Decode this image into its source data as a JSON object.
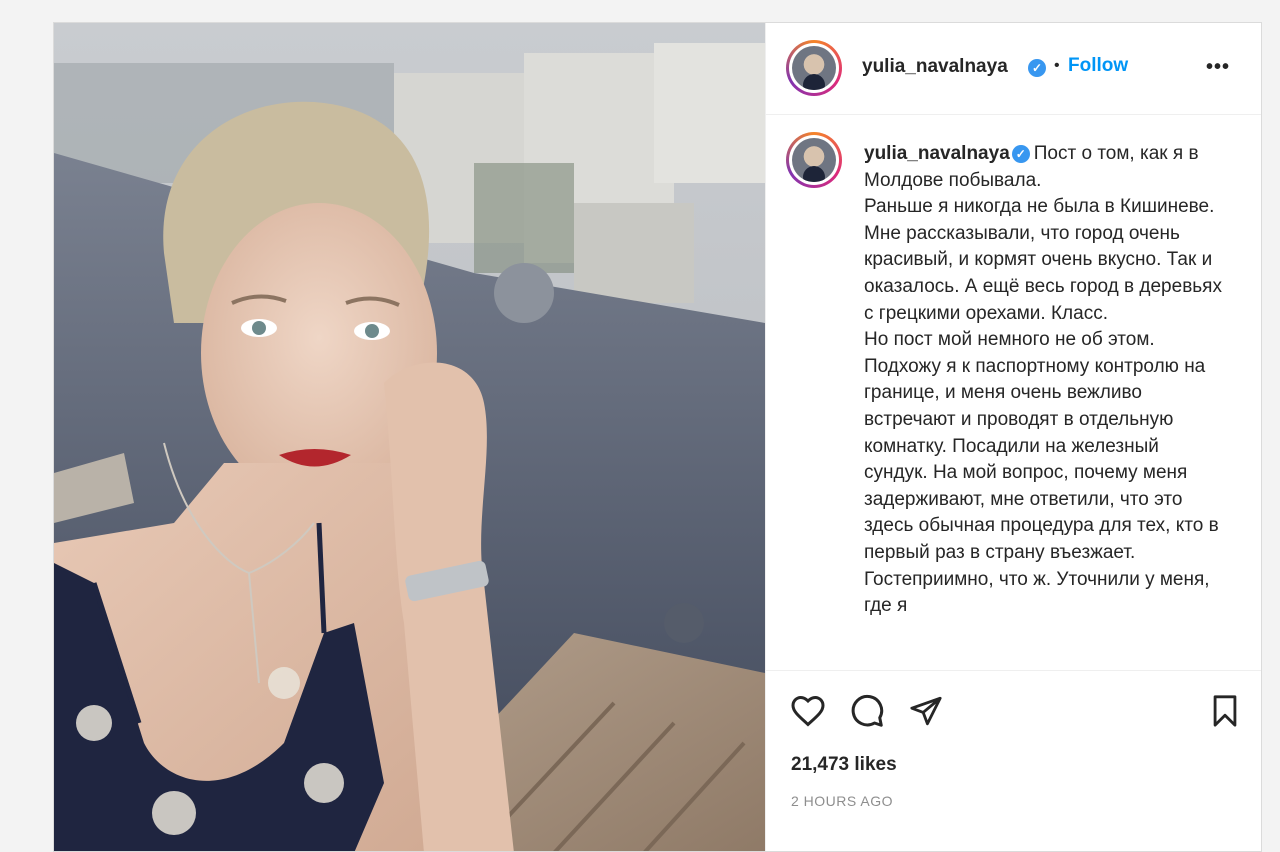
{
  "post": {
    "username": "yulia_navalnaya",
    "verified_icon": "verified-badge-icon",
    "follow_label": "Follow",
    "separator": "•",
    "more_label": "•••",
    "caption": "Пост о том, как я в Молдове побывала.\nРаньше я никогда не была в Кишиневе. Мне рассказывали, что город очень красивый, и кормят очень вкусно. Так и оказалось. А ещё весь город в деревьях с грецкими орехами. Класс.\nНо пост мой немного не об этом. Подхожу я к паспортному контролю на границе, и меня очень вежливо встречают и проводят в отдельную комнатку. Посадили на железный сундук. На мой вопрос, почему меня задерживают, мне ответили, что это здесь обычная процедура для тех, кто в первый раз в страну въезжает. Гостеприимно, что ж. Уточнили у меня, где я",
    "likes": "21,473 likes",
    "time": "2 HOURS AGO",
    "accent_color": "#0095f6",
    "verified_color": "#3897f0"
  }
}
